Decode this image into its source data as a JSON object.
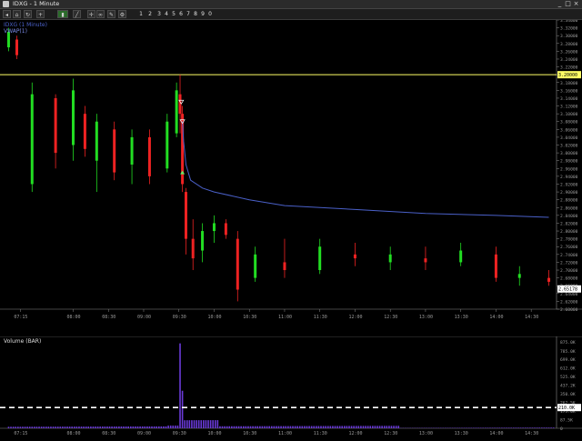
{
  "window": {
    "title": "IDXG - 1 Minute",
    "minimize": "_",
    "maximize": "□",
    "close": "×"
  },
  "toolbar": {
    "numbers": [
      "1",
      "2",
      "3",
      "4",
      "5",
      "6",
      "7",
      "8",
      "9",
      "0"
    ],
    "icons": [
      "back-icon",
      "home-icon",
      "refresh-icon",
      "zoom-icon",
      "bar-icon",
      "line-icon",
      "crosshair-icon",
      "link-icon",
      "draw-icon",
      "settings-icon"
    ]
  },
  "price_panel": {
    "legend": {
      "primary": "IDXG (1 Minute)",
      "vwap": "VWAP(1)"
    },
    "current_price_label": "2.65178",
    "hline_label": "3.20000",
    "colors": {
      "up": "#22dd22",
      "down": "#ee2222",
      "vwap": "#4a60c8",
      "hline": "#ffff66",
      "axis": "#8a8a8a"
    }
  },
  "volume_panel": {
    "legend": "Volume (BAR)",
    "threshold_label": "210.0K",
    "colors": {
      "bar": "#6a3ad8",
      "threshold": "#ffffff"
    }
  },
  "chart_data": [
    {
      "type": "candlestick",
      "title": "IDXG (1 Minute)",
      "x_tick_labels": [
        "07:15",
        "08:00",
        "08:30",
        "09:00",
        "09:30",
        "10:00",
        "10:30",
        "11:00",
        "11:30",
        "12:00",
        "12:30",
        "13:00",
        "13:30",
        "14:00",
        "14:30"
      ],
      "y_tick_labels": [
        "3.34000",
        "3.32000",
        "3.30000",
        "3.28000",
        "3.26000",
        "3.24000",
        "3.22000",
        "3.20000",
        "3.18000",
        "3.16000",
        "3.14000",
        "3.12000",
        "3.10000",
        "3.08000",
        "3.06000",
        "3.04000",
        "3.02000",
        "3.00000",
        "2.98000",
        "2.96000",
        "2.94000",
        "2.92000",
        "2.90000",
        "2.88000",
        "2.86000",
        "2.84000",
        "2.82000",
        "2.80000",
        "2.78000",
        "2.76000",
        "2.74000",
        "2.72000",
        "2.70000",
        "2.68000",
        "2.66000",
        "2.64000",
        "2.62000",
        "2.60000"
      ],
      "ylim": [
        2.6,
        3.34
      ],
      "series": [
        {
          "name": "VWAP(1)",
          "x": [
            "09:33",
            "09:34",
            "09:36",
            "09:40",
            "09:50",
            "10:00",
            "10:30",
            "11:00",
            "12:00",
            "13:00",
            "14:00",
            "14:45"
          ],
          "values": [
            3.08,
            3.03,
            2.97,
            2.93,
            2.91,
            2.9,
            2.88,
            2.865,
            2.855,
            2.845,
            2.84,
            2.835
          ]
        }
      ],
      "ohlc_estimated": [
        [
          "07:05",
          3.27,
          3.32,
          3.26,
          3.31
        ],
        [
          "07:12",
          3.29,
          3.3,
          3.24,
          3.25
        ],
        [
          "07:25",
          2.92,
          3.18,
          2.9,
          3.15
        ],
        [
          "07:45",
          3.14,
          3.15,
          2.96,
          3.0
        ],
        [
          "08:00",
          3.02,
          3.19,
          2.98,
          3.16
        ],
        [
          "08:10",
          3.1,
          3.12,
          2.99,
          3.01
        ],
        [
          "08:20",
          2.98,
          3.1,
          2.9,
          3.08
        ],
        [
          "08:35",
          3.06,
          3.08,
          2.93,
          2.95
        ],
        [
          "08:50",
          2.97,
          3.06,
          2.92,
          3.04
        ],
        [
          "09:05",
          3.04,
          3.06,
          2.92,
          2.94
        ],
        [
          "09:20",
          2.96,
          3.1,
          2.95,
          3.08
        ],
        [
          "09:28",
          3.05,
          3.18,
          3.04,
          3.16
        ],
        [
          "09:31",
          3.15,
          3.2,
          3.05,
          3.1
        ],
        [
          "09:33",
          3.1,
          3.12,
          2.9,
          2.92
        ],
        [
          "09:36",
          2.9,
          2.91,
          2.74,
          2.78
        ],
        [
          "09:42",
          2.78,
          2.83,
          2.7,
          2.73
        ],
        [
          "09:50",
          2.75,
          2.82,
          2.72,
          2.8
        ],
        [
          "10:00",
          2.8,
          2.84,
          2.77,
          2.82
        ],
        [
          "10:10",
          2.82,
          2.83,
          2.78,
          2.79
        ],
        [
          "10:20",
          2.78,
          2.8,
          2.62,
          2.65
        ],
        [
          "10:35",
          2.68,
          2.76,
          2.67,
          2.74
        ],
        [
          "11:00",
          2.72,
          2.78,
          2.68,
          2.7
        ],
        [
          "11:30",
          2.7,
          2.78,
          2.69,
          2.76
        ],
        [
          "12:00",
          2.74,
          2.77,
          2.71,
          2.73
        ],
        [
          "12:30",
          2.72,
          2.76,
          2.7,
          2.74
        ],
        [
          "13:00",
          2.73,
          2.76,
          2.7,
          2.72
        ],
        [
          "13:30",
          2.72,
          2.77,
          2.71,
          2.75
        ],
        [
          "14:00",
          2.74,
          2.76,
          2.67,
          2.68
        ],
        [
          "14:20",
          2.68,
          2.71,
          2.66,
          2.69
        ],
        [
          "14:45",
          2.68,
          2.7,
          2.66,
          2.67
        ]
      ],
      "hline": 3.2,
      "last_price": 2.65178,
      "markers": [
        {
          "x": "09:32",
          "y": 3.13,
          "type": "sell"
        },
        {
          "x": "09:33",
          "y": 3.08,
          "type": "sell"
        },
        {
          "x": "09:33",
          "y": 2.95,
          "type": "buy"
        }
      ]
    },
    {
      "type": "bar",
      "title": "Volume (BAR)",
      "y_tick_labels": [
        "875.0K",
        "785.0K",
        "699.0K",
        "612.0K",
        "525.0K",
        "437.2K",
        "350.0K",
        "262.5K",
        "210.0K",
        "175.0K",
        "87.5K",
        "0"
      ],
      "ylim": [
        0,
        875000
      ],
      "threshold": 210000,
      "peak_volume_estimated": 860000
    }
  ]
}
